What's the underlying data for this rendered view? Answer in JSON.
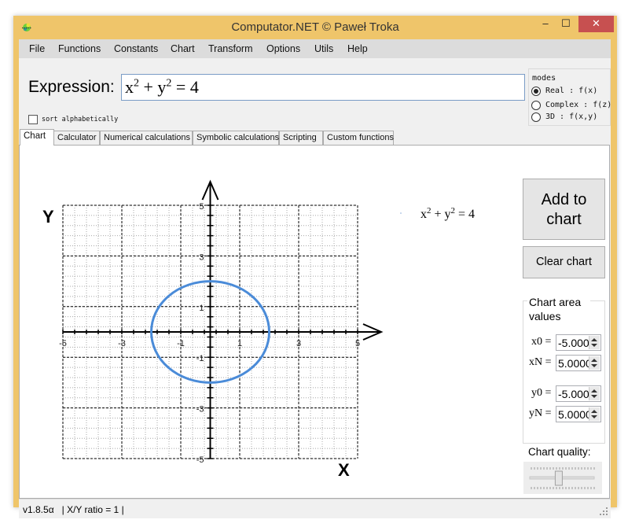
{
  "window": {
    "title": "Computator.NET © Paweł Troka",
    "controls": {
      "minimize": "‒",
      "maximize": "☐",
      "close": "✕"
    }
  },
  "menu": [
    "File",
    "Functions",
    "Constants",
    "Chart",
    "Transform",
    "Options",
    "Utils",
    "Help"
  ],
  "expression": {
    "label": "Expression:",
    "value_parts": {
      "a": "x",
      "a_exp": "2",
      "op": " + ",
      "b": "y",
      "b_exp": "2",
      "rest": " = 4"
    },
    "sort_label": "sort alphabetically",
    "sort_checked": false
  },
  "modes": {
    "legend": "modes",
    "options": [
      {
        "label": "Real : f(x)",
        "checked": true
      },
      {
        "label": "Complex : f(z)",
        "checked": false
      },
      {
        "label": "3D : f(x,y)",
        "checked": false
      }
    ]
  },
  "tabs": [
    {
      "label": "Chart",
      "active": true
    },
    {
      "label": "Calculator",
      "active": false
    },
    {
      "label": "Numerical calculations",
      "active": false
    },
    {
      "label": "Symbolic calculations",
      "active": false
    },
    {
      "label": "Scripting",
      "active": false
    },
    {
      "label": "Custom functions",
      "active": false
    }
  ],
  "chart_panel": {
    "add_button": "Add to chart",
    "clear_button": "Clear chart",
    "area_group_title": "Chart area values",
    "fields": [
      {
        "label": "x0 =",
        "value": "-5.000"
      },
      {
        "label": "xN =",
        "value": "5.0000"
      },
      {
        "label": "y0 =",
        "value": "-5.000"
      },
      {
        "label": "yN =",
        "value": "5.0000"
      }
    ],
    "quality_label": "Chart quality:",
    "quality_fraction": 0.45
  },
  "chart_data": {
    "type": "line",
    "title": "",
    "xlabel": "X",
    "ylabel": "Y",
    "xlim": [
      -5,
      5
    ],
    "ylim": [
      -5,
      5
    ],
    "grid": true,
    "x_ticks": [
      "-5",
      "-3",
      "-1",
      "1",
      "3",
      "5"
    ],
    "y_ticks": [
      "5",
      "3",
      "1",
      "-1",
      "-3",
      "-5"
    ],
    "legend": "top-right",
    "series": [
      {
        "name": "x² + y² = 4",
        "kind": "implicit-circle",
        "center": [
          0,
          0
        ],
        "radius": 2,
        "color": "#4A8BD8"
      }
    ],
    "legend_parts": {
      "a": "x",
      "a_exp": "2",
      "op": " + ",
      "b": "y",
      "b_exp": "2",
      "rest": " = 4"
    }
  },
  "status": {
    "text": "v1.8.5α   | X/Y ratio = 1 |"
  }
}
